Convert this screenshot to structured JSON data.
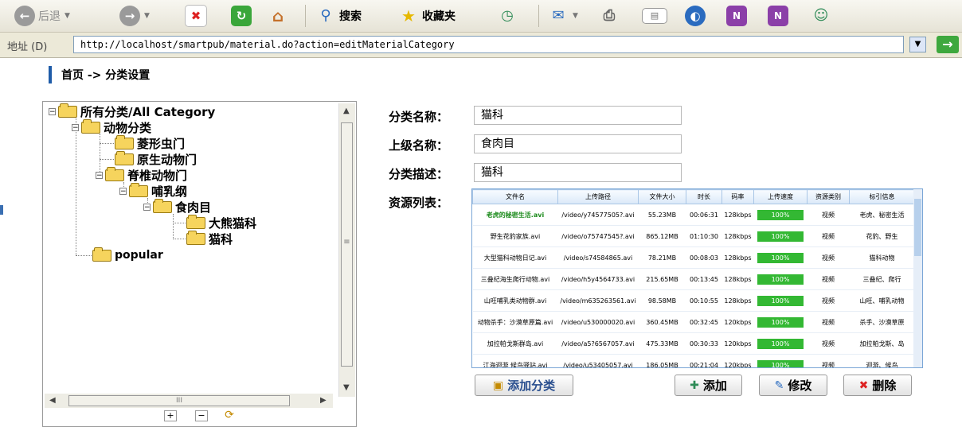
{
  "toolbar": {
    "back_label": "后退",
    "search_label": "搜索",
    "favorites_label": "收藏夹"
  },
  "address_bar": {
    "label": "地址 (D)",
    "url": "http://localhost/smartpub/material.do?action=editMaterialCategory"
  },
  "breadcrumb": "首页 -> 分类设置",
  "tree": {
    "nodes": [
      {
        "label": "所有分类/All Category",
        "expanded": true
      },
      {
        "label": "动物分类",
        "expanded": true
      },
      {
        "label": "菱形虫门"
      },
      {
        "label": "原生动物门"
      },
      {
        "label": "脊椎动物门",
        "expanded": true
      },
      {
        "label": "哺乳纲",
        "expanded": true
      },
      {
        "label": "食肉目",
        "expanded": true
      },
      {
        "label": "大熊猫科"
      },
      {
        "label": "猫科"
      },
      {
        "label": "popular"
      }
    ]
  },
  "form": {
    "name_label": "分类名称：",
    "name_value": "猫科",
    "parent_label": "上级名称：",
    "parent_value": "食肉目",
    "desc_label": "分类描述：",
    "desc_value": "猫科",
    "resource_label": "资源列表："
  },
  "resource_table": {
    "columns": [
      "文件名",
      "上传路径",
      "文件大小",
      "时长",
      "码率",
      "上传速度",
      "资源类别",
      "标引信息"
    ],
    "rows": [
      {
        "name": "老虎的秘密生活.avi",
        "path": "/video/y74577505?.avi",
        "size": "55.23MB",
        "duration": "00:06:31",
        "bitrate": "128kbps",
        "progress": "100%",
        "category": "视频",
        "tags": "老虎、秘密生活"
      },
      {
        "name": "野生花豹家族.avi",
        "path": "/video/o75747545?.avi",
        "size": "865.12MB",
        "duration": "01:10:30",
        "bitrate": "128kbps",
        "progress": "100%",
        "category": "视频",
        "tags": "花豹、野生"
      },
      {
        "name": "大型猫科动物日记.avi",
        "path": "/video/s74584865.avi",
        "size": "78.21MB",
        "duration": "00:08:03",
        "bitrate": "128kbps",
        "progress": "100%",
        "category": "视频",
        "tags": "猫科动物"
      },
      {
        "name": "三叠纪海生爬行动物.avi",
        "path": "/video/h5y4564733.avi",
        "size": "215.65MB",
        "duration": "00:13:45",
        "bitrate": "128kbps",
        "progress": "100%",
        "category": "视频",
        "tags": "三叠纪、爬行"
      },
      {
        "name": "山旺哺乳类动物群.avi",
        "path": "/video/m635263561.avi",
        "size": "98.58MB",
        "duration": "00:10:55",
        "bitrate": "128kbps",
        "progress": "100%",
        "category": "视频",
        "tags": "山旺、哺乳动物"
      },
      {
        "name": "动物杀手：沙漠草原篇.avi",
        "path": "/video/u530000020.avi",
        "size": "360.45MB",
        "duration": "00:32:45",
        "bitrate": "120kbps",
        "progress": "100%",
        "category": "视频",
        "tags": "杀手、沙漠草原"
      },
      {
        "name": "加拉帕戈斯群岛.avi",
        "path": "/video/a5?6567057.avi",
        "size": "475.33MB",
        "duration": "00:30:33",
        "bitrate": "120kbps",
        "progress": "100%",
        "category": "视频",
        "tags": "加拉帕戈斯、岛"
      },
      {
        "name": "江海迴游 候鸟驿站.avi",
        "path": "/video/u53405057.avi",
        "size": "186.05MB",
        "duration": "00:21:04",
        "bitrate": "120kbps",
        "progress": "100%",
        "category": "视频",
        "tags": "迴游、候鸟"
      }
    ]
  },
  "buttons": {
    "add_category": "添加分类",
    "add": "添加",
    "edit": "修改",
    "delete": "删除"
  },
  "colors": {
    "progress": "#33b833",
    "highlight_row_text": "#1a8a1a",
    "accent": "#1f5ca8"
  }
}
